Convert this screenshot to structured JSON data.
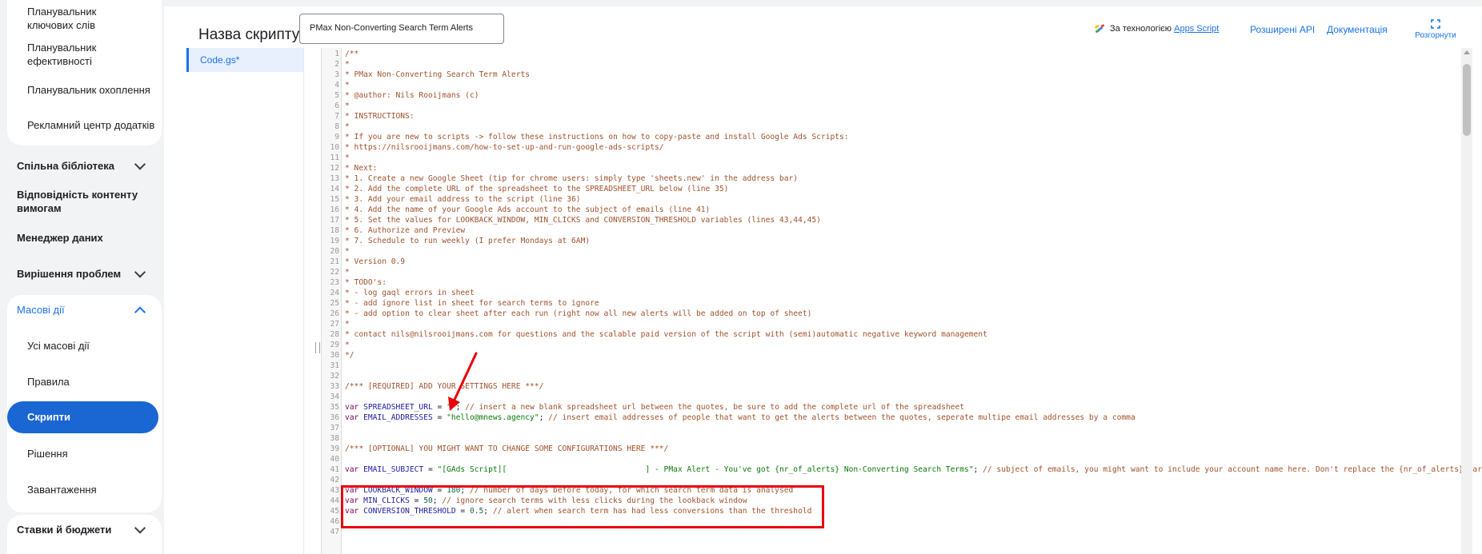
{
  "sidebar": {
    "tools_items": [
      "Планувальник ключових слів",
      "Планувальник ефективності",
      "Планувальник охоплення",
      "Рекламний центр додатків"
    ],
    "shared_library": "Спільна бібліотека",
    "content_compliance": "Відповідність контенту вимогам",
    "data_manager": "Менеджер даних",
    "troubleshooting": "Вирішення проблем",
    "bulk_actions": "Масові дії",
    "bulk_items": [
      "Усі масові дії",
      "Правила",
      "Скрипти",
      "Рішення",
      "Завантаження"
    ],
    "bids_budgets": "Ставки й бюджети"
  },
  "header": {
    "title_label": "Назва скрипту:",
    "title_value": "PMax Non-Converting Search Term Alerts",
    "powered_by": "За технологією",
    "apps_script": "Apps Script",
    "advanced_apis": "Розширені API",
    "documentation": "Документація",
    "expand": "Розгорнути"
  },
  "files": {
    "active": "Code.gs*"
  },
  "colors": {
    "accent": "#1a73e8",
    "active_pill": "#1a66d2",
    "highlight": "#e8000b"
  },
  "icons": {
    "expand": "expand-icon",
    "chevron": "chevron-down-icon",
    "apps_script": "apps-script-icon"
  },
  "code_lines": [
    [
      [
        "c",
        "/**"
      ]
    ],
    [
      [
        "c",
        "*"
      ]
    ],
    [
      [
        "c",
        "* PMax Non-Converting Search Term Alerts"
      ]
    ],
    [
      [
        "c",
        "*"
      ]
    ],
    [
      [
        "c",
        "* @author: Nils Rooijmans (c)"
      ]
    ],
    [
      [
        "c",
        "*"
      ]
    ],
    [
      [
        "c",
        "* INSTRUCTIONS:"
      ]
    ],
    [
      [
        "c",
        "*"
      ]
    ],
    [
      [
        "c",
        "* If you are new to scripts -> follow these instructions on how to copy-paste and install Google Ads Scripts:"
      ]
    ],
    [
      [
        "c",
        "* https://nilsrooijmans.com/how-to-set-up-and-run-google-ads-scripts/"
      ]
    ],
    [
      [
        "c",
        "*"
      ]
    ],
    [
      [
        "c",
        "* Next:"
      ]
    ],
    [
      [
        "c",
        "* 1. Create a new Google Sheet (tip for chrome users: simply type 'sheets.new' in the address bar)"
      ]
    ],
    [
      [
        "c",
        "* 2. Add the complete URL of the spreadsheet to the SPREADSHEET_URL below (line 35)"
      ]
    ],
    [
      [
        "c",
        "* 3. Add your email address to the script (line 36)"
      ]
    ],
    [
      [
        "c",
        "* 4. Add the name of your Google Ads account to the subject of emails (line 41)"
      ]
    ],
    [
      [
        "c",
        "* 5. Set the values for LOOKBACK_WINDOW, MIN_CLICKS and CONVERSION_THRESHOLD variables (lines 43,44,45)"
      ]
    ],
    [
      [
        "c",
        "* 6. Authorize and Preview"
      ]
    ],
    [
      [
        "c",
        "* 7. Schedule to run weekly (I prefer Mondays at 6AM)"
      ]
    ],
    [
      [
        "c",
        "*"
      ]
    ],
    [
      [
        "c",
        "* Version 0.9"
      ]
    ],
    [
      [
        "c",
        "*"
      ]
    ],
    [
      [
        "c",
        "* TODO's:"
      ]
    ],
    [
      [
        "c",
        "* - log gaql errors in sheet"
      ]
    ],
    [
      [
        "c",
        "* - add ignore list in sheet for search terms to ignore"
      ]
    ],
    [
      [
        "c",
        "* - add option to clear sheet after each run (right now all new alerts will be added on top of sheet)"
      ]
    ],
    [
      [
        "c",
        "*"
      ]
    ],
    [
      [
        "c",
        "* contact nils@nilsrooijmans.com for questions and the scalable paid version of the script with (semi)automatic negative keyword management"
      ]
    ],
    [
      [
        "c",
        "*"
      ]
    ],
    [
      [
        "c",
        "*/"
      ]
    ],
    [],
    [],
    [
      [
        "c",
        "/*** [REQUIRED] ADD YOUR SETTINGS HERE ***/"
      ]
    ],
    [],
    [
      [
        "k",
        "var "
      ],
      [
        "v",
        "SPREADSHEET_URL"
      ],
      [
        "p",
        " = "
      ],
      [
        "s",
        "\"\""
      ],
      [
        "p",
        "; "
      ],
      [
        "c",
        "// insert a new blank spreadsheet url between the quotes, be sure to add the complete url of the spreadsheet"
      ]
    ],
    [
      [
        "k",
        "var "
      ],
      [
        "v",
        "EMAIL_ADDRESSES"
      ],
      [
        "p",
        " = "
      ],
      [
        "s",
        "\"hello@mnews.agency\""
      ],
      [
        "p",
        "; "
      ],
      [
        "c",
        "// insert email addresses of people that want to get the alerts between the quotes, seperate multipe email addresses by a comma"
      ]
    ],
    [],
    [],
    [
      [
        "c",
        "/*** [OPTIONAL] YOU MIGHT WANT TO CHANGE SOME CONFIGURATIONS HERE ***/"
      ]
    ],
    [],
    [
      [
        "k",
        "var "
      ],
      [
        "v",
        "EMAIL_SUBJECT"
      ],
      [
        "p",
        " = "
      ],
      [
        "s",
        "\"[GAds Script][                              ] - PMax Alert - You've got {nr_of_alerts} Non-Converting Search Terms\""
      ],
      [
        "p",
        "; "
      ],
      [
        "c",
        "// subject of emails, you might want to include your account name here. Don't replace the {nr_of_alerts} part."
      ]
    ],
    [],
    [
      [
        "k",
        "var "
      ],
      [
        "v",
        "LOOKBACK_WINDOW"
      ],
      [
        "p",
        " = "
      ],
      [
        "n",
        "180"
      ],
      [
        "p",
        "; "
      ],
      [
        "c",
        "// number of days before today, for which search term data is analysed"
      ]
    ],
    [
      [
        "k",
        "var "
      ],
      [
        "v",
        "MIN_CLICKS"
      ],
      [
        "p",
        " = "
      ],
      [
        "n",
        "50"
      ],
      [
        "p",
        "; "
      ],
      [
        "c",
        "// ignore search terms with less clicks during the lookback window"
      ]
    ],
    [
      [
        "k",
        "var "
      ],
      [
        "v",
        "CONVERSION_THRESHOLD"
      ],
      [
        "p",
        " = "
      ],
      [
        "n",
        "0.5"
      ],
      [
        "p",
        "; "
      ],
      [
        "c",
        "// alert when search term has had less conversions than the threshold"
      ]
    ],
    [],
    []
  ]
}
